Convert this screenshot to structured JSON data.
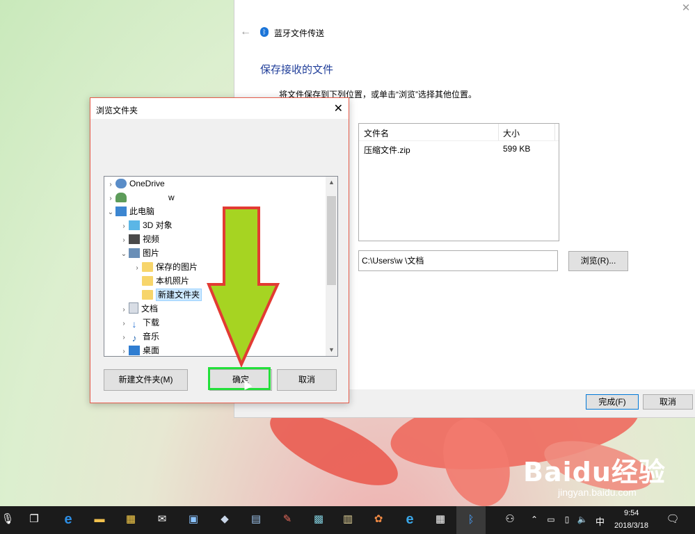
{
  "bt_window": {
    "title": "蓝牙文件传送",
    "heading": "保存接收的文件",
    "description": "将文件保存到下列位置，或单击“浏览”选择其他位置。",
    "columns": {
      "name": "文件名",
      "size": "大小"
    },
    "file": {
      "name": "压缩文件.zip",
      "size": "599 KB"
    },
    "path": "C:\\Users\\w       \\文档",
    "browse_label": "浏览(R)...",
    "finish_label": "完成(F)",
    "cancel_label": "取消"
  },
  "browse_dialog": {
    "title": "浏览文件夹",
    "tree": [
      {
        "label": "OneDrive",
        "icon": "onedrive-icon"
      },
      {
        "label": "w",
        "icon": "user-icon"
      },
      {
        "label": "此电脑",
        "icon": "computer-icon"
      },
      {
        "label": "3D 对象",
        "icon": "3d-objects-icon"
      },
      {
        "label": "视频",
        "icon": "video-icon"
      },
      {
        "label": "图片",
        "icon": "pictures-icon"
      },
      {
        "label": "保存的图片",
        "icon": "folder-icon"
      },
      {
        "label": "本机照片",
        "icon": "folder-icon"
      },
      {
        "label": "新建文件夹",
        "icon": "folder-icon"
      },
      {
        "label": "文档",
        "icon": "documents-icon"
      },
      {
        "label": "下载",
        "icon": "download-icon"
      },
      {
        "label": "音乐",
        "icon": "music-icon"
      },
      {
        "label": "桌面",
        "icon": "desktop-icon"
      }
    ],
    "new_folder_label": "新建文件夹(M)",
    "ok_label": "确定",
    "cancel_label": "取消"
  },
  "taskbar": {
    "ime": "中",
    "time": "9:54",
    "date": "2018/3/18"
  },
  "watermark": {
    "brand": "Baidu经验",
    "site": "jingyan.baidu.com"
  },
  "colors": {
    "arrow_fill": "#a6d422",
    "arrow_stroke": "#e23b33",
    "highlight_box": "#23e03a",
    "heading": "#1f3d99",
    "bluetooth": "#1a74d8"
  }
}
